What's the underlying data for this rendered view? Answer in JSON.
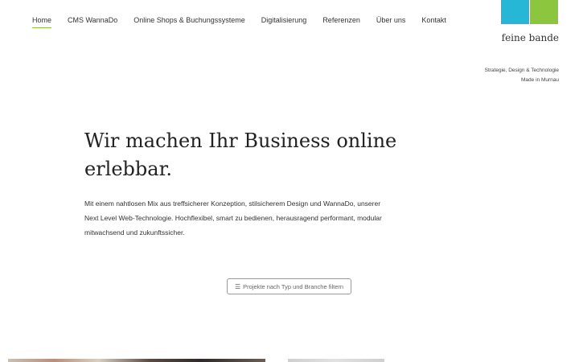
{
  "nav": {
    "items": [
      {
        "label": "Home",
        "active": true
      },
      {
        "label": "CMS WannaDo",
        "active": false
      },
      {
        "label": "Online Shops & Buchungssysteme",
        "active": false
      },
      {
        "label": "Digitalisierung",
        "active": false
      },
      {
        "label": "Referenzen",
        "active": false
      },
      {
        "label": "Über uns",
        "active": false
      },
      {
        "label": "Kontakt",
        "active": false
      }
    ]
  },
  "logo": {
    "text": "feine bande",
    "colors": [
      "#26b6d6",
      "#8cc63f"
    ]
  },
  "tagline": {
    "line1": "Strategie, Design & Technologie",
    "line2": "Made in Murnau"
  },
  "hero": {
    "headline": "Wir machen Ihr Business online erlebbar.",
    "intro": "Mit einem nahtlosen Mix aus treffsicherer Konzeption, stilsicherem Design und WannaDo, unserer Next Level Web-Technologie. Hochflexibel, smart zu bedienen, herausragend performant, modular mitwachsend und zukunftssicher."
  },
  "filter": {
    "label": "Projekte nach Typ und Branche filtern",
    "icon": "sliders-icon"
  },
  "colors": {
    "accent": "#8cc63f",
    "brand_blue": "#26b6d6"
  }
}
